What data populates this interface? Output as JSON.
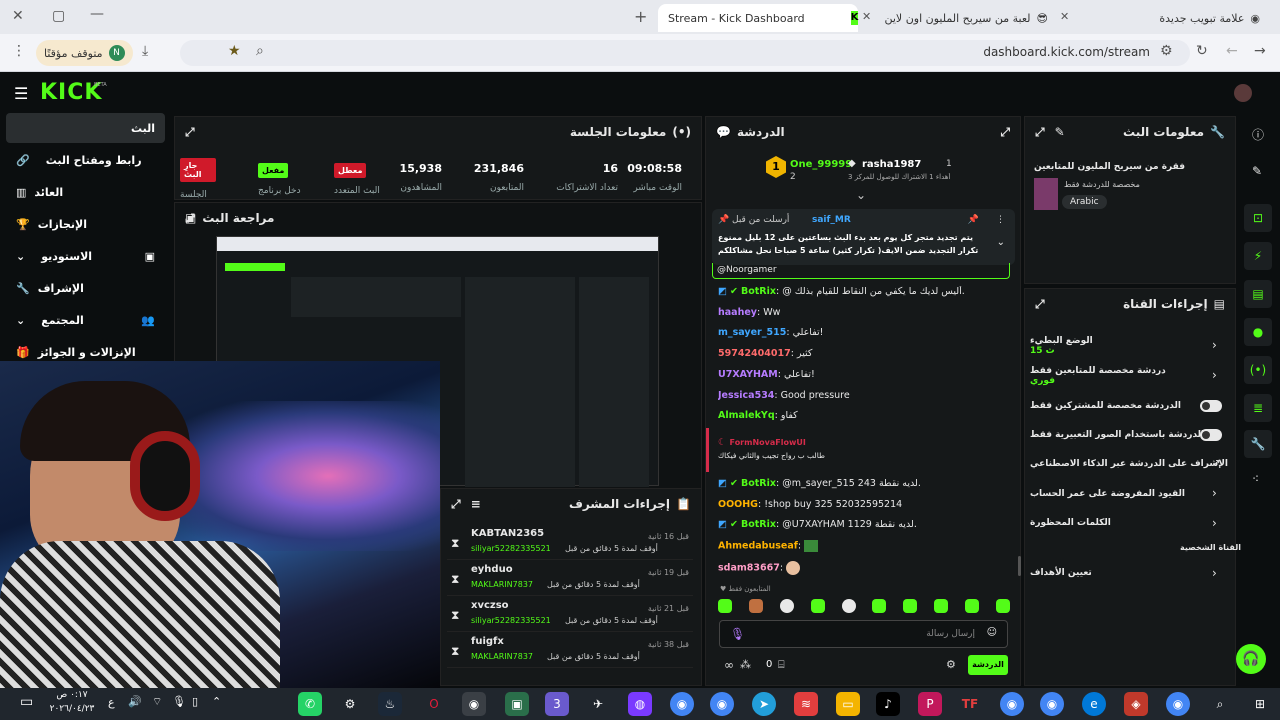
{
  "browser": {
    "tabs": [
      {
        "label": "علامة تبويب جديدة"
      },
      {
        "label": "لعبة من سيربح المليون اون لاين"
      },
      {
        "label": "Stream - Kick Dashboard"
      }
    ],
    "url": "dashboard.kick.com/stream",
    "profile_label": "متوقف مؤقتًا",
    "profile_initial": "N"
  },
  "app": {
    "logo": "KICK",
    "logo_beta": "BETA"
  },
  "sidebar": {
    "items": [
      {
        "label": "البث"
      },
      {
        "label": "رابط ومفتاح البث"
      },
      {
        "label": "العائد"
      },
      {
        "label": "الإنجازات"
      },
      {
        "label": "الاستوديو"
      },
      {
        "label": "الإشراف"
      },
      {
        "label": "المجتمع"
      },
      {
        "label": "الإنزالات و الجوائز"
      }
    ]
  },
  "session": {
    "title": "معلومات الجلسة",
    "badges": [
      {
        "label": "جارِ البث",
        "caption": "الجلسة",
        "color": "#d01a2a"
      },
      {
        "label": "مفعل",
        "caption": "دخل برنامج",
        "color": "#53fc18"
      },
      {
        "label": "معطل",
        "caption": "البث المتعدد",
        "color": "#d01a2a"
      }
    ],
    "stats": [
      {
        "value": "15,938",
        "label": "المشاهدون"
      },
      {
        "value": "231,846",
        "label": "المتابعون"
      },
      {
        "value": "16",
        "label": "تعداد الاشتراكات"
      },
      {
        "value": "09:08:58",
        "label": "الوقت مباشر"
      }
    ]
  },
  "review": {
    "title": "مراجعة البث"
  },
  "chat": {
    "title": "الدردشة",
    "leaderboard": [
      {
        "rank": "1",
        "name": "rasha1987",
        "count": "1"
      },
      {
        "name": "One_99999",
        "count": "2"
      }
    ],
    "leader_sub": "أهداء 1 الاشتراك للوصول للمركز 3",
    "pinned_user": "saif_MR",
    "pinned_suffix": "أرسلت من قبل",
    "pinned_text": "يتم تجديد متجر كل يوم بعد بدء البث بساعتين على 12 بليل ممنوع تكرار التجديد ضمن الايف( تكرار كثير) ساعة 5 صباحا نحل مشاكلكم بالمتجر .. فيديو كيف تربح",
    "reply_to": "@Noorgamer",
    "messages": [
      {
        "user": "BotRix",
        "color": "#53fc18",
        "text": "@ أليس لديك ما يكفي من النقاط للقيام بذلك."
      },
      {
        "user": "haahey",
        "color": "#b67cff",
        "text": "Ww"
      },
      {
        "user": "m_sayer_515",
        "color": "#3fa7ff",
        "text": "تفاعلي!"
      },
      {
        "user": "59742404017",
        "color": "#ff6b6b",
        "text": "كثير"
      },
      {
        "user": "U7XAYHAM",
        "color": "#b67cff",
        "text": "تفاعلي!"
      },
      {
        "user": "Jessica534",
        "color": "#b67cff",
        "text": "Good pressure"
      },
      {
        "user": "AlmalekYq",
        "color": "#53fc18",
        "text": "كفاو"
      },
      {
        "user": "FormNovaFlowUI",
        "color": "#d62c4a",
        "text": "طالب ب رواج تجيب والثاني فيكاك"
      },
      {
        "user": "BotRix",
        "color": "#53fc18",
        "text": "@m_sayer_515 243 لديه نقطة."
      },
      {
        "user": "OOOHG",
        "color": "#ffb300",
        "text": "!shop buy 325 52032595214"
      },
      {
        "user": "BotRix",
        "color": "#53fc18",
        "text": "@U7XAYHAM 1129 لديه نقطة."
      },
      {
        "user": "Ahmedabuseaf",
        "color": "#ffb300",
        "text": ""
      },
      {
        "user": "sdam83667",
        "color": "#ff9ec7",
        "text": ""
      }
    ],
    "followers_only": "المتابعون فقط",
    "input_placeholder": "إرسال رسالة",
    "send_label": "الدردشة",
    "count": "0"
  },
  "moderator": {
    "title": "إجراءات المشرف",
    "rows": [
      {
        "user": "KABTAN2365",
        "action": "أوقف لمدة 5 دقائق من قبل",
        "by": "siliyar52282335521",
        "time": "قبل 16 ثانية"
      },
      {
        "user": "eyhduo",
        "action": "أوقف لمدة 5 دقائق من قبل",
        "by": "MAKLARIN7837",
        "time": "قبل 19 ثانية"
      },
      {
        "user": "xvczso",
        "action": "أوقف لمدة 5 دقائق من قبل",
        "by": "siliyar52282335521",
        "time": "قبل 21 ثانية"
      },
      {
        "user": "fuigfx",
        "action": "أوقف لمدة 5 دقائق من قبل",
        "by": "MAKLARIN7837",
        "time": "قبل 38 ثانية"
      }
    ]
  },
  "stream_info": {
    "title": "معلومات البث",
    "stream_title": "فقرة من سيربح المليون للمتابعين",
    "category": "مخصصة للدردشة فقط",
    "language": "Arabic"
  },
  "channel_actions": {
    "title": "إجراءات القناة",
    "rows": [
      {
        "label": "الوضع البطيء",
        "sub": "15 ث"
      },
      {
        "label": "دردشة مخصصة للمتابعين فقط",
        "sub": "فوري"
      },
      {
        "label": "الدردشة مخصصة للمشتركين فقط",
        "sub": ""
      },
      {
        "label": "الدردشة باستخدام الصور التعبيرية فقط",
        "sub": ""
      },
      {
        "label": "الإشراف على الدردشة عبر الذكاء الاصطناعي",
        "sub": ""
      },
      {
        "label": "القيود المفروضة على عمر الحساب",
        "sub": ""
      },
      {
        "label": "الكلمات المحظورة",
        "sub": ""
      }
    ],
    "section_personal": "القناة الشخصية",
    "goals": "تعيين الأهداف"
  },
  "taskbar": {
    "time": "٠:١٧ ص",
    "date": "٢٠٢٦/٠٤/٢٣",
    "lang": "ع"
  }
}
